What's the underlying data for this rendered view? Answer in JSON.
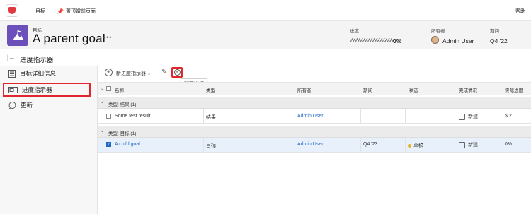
{
  "topbar": {
    "goals_label": "目标",
    "pin_label": "置顶當前页面",
    "help_label": "帮助"
  },
  "header": {
    "object_type": "目标",
    "title": "A parent goal",
    "progress_label": "进度",
    "progress_value": "0%",
    "owner_label": "所有者",
    "owner_name": "Admin User",
    "period_label": "期间",
    "period_value": "Q4 '22"
  },
  "section": {
    "title": "进度指示器"
  },
  "sidebar": {
    "items": [
      {
        "label": "目标详细信息",
        "icon": "document-icon"
      },
      {
        "label": "进度指示器",
        "icon": "progress-indicator-icon"
      },
      {
        "label": "更新",
        "icon": "comment-icon"
      }
    ]
  },
  "toolbar": {
    "new_indicator_label": "新进度指示器",
    "unlink_tooltip": "断开连接"
  },
  "table": {
    "columns": [
      "名称",
      "类型",
      "所有者",
      "期间",
      "状态",
      "完成情况",
      "实际进度"
    ],
    "groups": [
      {
        "label": "类型: 结果 (1)",
        "rows": [
          {
            "name": "Some test result",
            "type": "结果",
            "owner": "Admin User",
            "period": "",
            "status": "",
            "completion": "新建",
            "actual": "$ 2",
            "checked": false
          }
        ]
      },
      {
        "label": "类型: 目标 (1)",
        "rows": [
          {
            "name": "A child goal",
            "type": "目标",
            "owner": "Admin User",
            "period": "Q4 '23",
            "status": "草稿",
            "completion": "新建",
            "actual": "0%",
            "checked": true
          }
        ]
      }
    ]
  },
  "colors": {
    "accent_red": "#e1272d",
    "goal_purple": "#6b4fbb",
    "link_blue": "#2167c4",
    "status_yellow": "#e8b21a"
  }
}
